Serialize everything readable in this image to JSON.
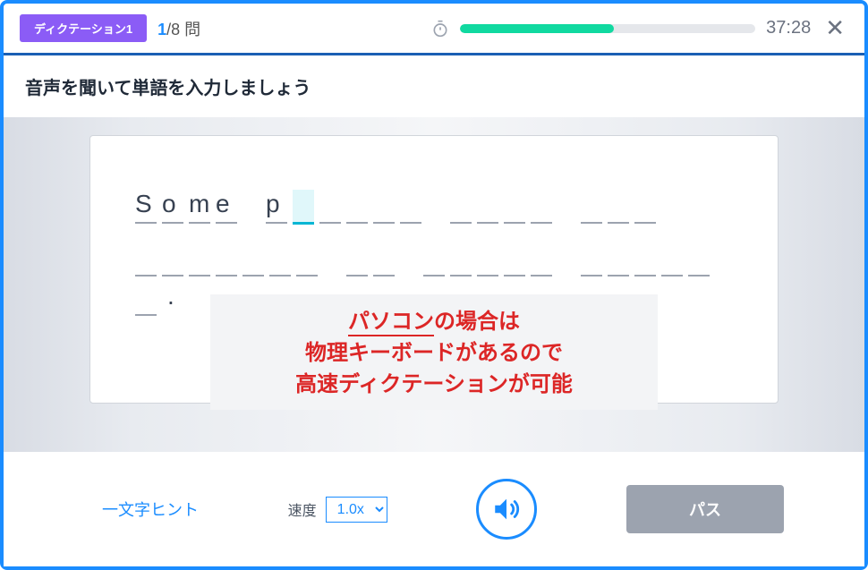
{
  "header": {
    "badge": "ディクテーション1",
    "current": "1",
    "total": "8",
    "unit": "問",
    "progress_percent": 52,
    "time": "37:28"
  },
  "instruction": "音声を聞いて単語を入力しましょう",
  "dictation": {
    "typed": "Some p",
    "row1_slots": [
      {
        "c": "S",
        "s": "filled"
      },
      {
        "c": "o",
        "s": "filled"
      },
      {
        "c": "m",
        "s": "filled"
      },
      {
        "c": "e",
        "s": "filled"
      },
      {
        "gap": true
      },
      {
        "c": "p",
        "s": "filled"
      },
      {
        "c": "",
        "s": "current"
      },
      {
        "c": "",
        "s": "empty"
      },
      {
        "c": "",
        "s": "empty"
      },
      {
        "c": "",
        "s": "empty"
      },
      {
        "c": "",
        "s": "empty"
      },
      {
        "gap": true
      },
      {
        "c": "",
        "s": "empty"
      },
      {
        "c": "",
        "s": "empty"
      },
      {
        "c": "",
        "s": "empty"
      },
      {
        "c": "",
        "s": "empty"
      },
      {
        "gap": true
      },
      {
        "c": "",
        "s": "empty"
      },
      {
        "c": "",
        "s": "empty"
      },
      {
        "c": "",
        "s": "empty"
      }
    ],
    "row2_slots": [
      {
        "c": "",
        "s": "empty"
      },
      {
        "c": "",
        "s": "empty"
      },
      {
        "c": "",
        "s": "empty"
      },
      {
        "c": "",
        "s": "empty"
      },
      {
        "c": "",
        "s": "empty"
      },
      {
        "c": "",
        "s": "empty"
      },
      {
        "c": "",
        "s": "empty"
      },
      {
        "gap": true
      },
      {
        "c": "",
        "s": "empty"
      },
      {
        "c": "",
        "s": "empty"
      },
      {
        "gap": true
      },
      {
        "c": "",
        "s": "empty"
      },
      {
        "c": "",
        "s": "empty"
      },
      {
        "c": "",
        "s": "empty"
      },
      {
        "c": "",
        "s": "empty"
      },
      {
        "c": "",
        "s": "empty"
      },
      {
        "gap": true
      },
      {
        "c": "",
        "s": "empty"
      },
      {
        "c": "",
        "s": "empty"
      },
      {
        "c": "",
        "s": "empty"
      },
      {
        "c": "",
        "s": "empty"
      },
      {
        "c": "",
        "s": "empty"
      },
      {
        "c": "",
        "s": "empty"
      }
    ]
  },
  "annotation": {
    "line1_a": "パソコン",
    "line1_b": "の場合は",
    "line2": "物理キーボードがあるので",
    "line3": "高速ディクテーションが可能"
  },
  "footer": {
    "hint": "一文字ヒント",
    "speed_label": "速度",
    "speed_value": "1.0x",
    "pass": "パス"
  }
}
